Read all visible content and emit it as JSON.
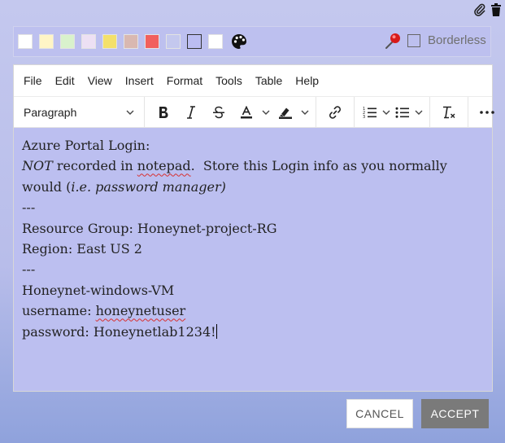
{
  "top_icons": {
    "attach": "paperclip-icon",
    "delete": "trash-icon"
  },
  "palette": {
    "swatches": [
      "#ffffff",
      "#fff5c6",
      "#d9f2cc",
      "#ede0f4",
      "#f4e06b",
      "#d9b8b1",
      "#f1605d",
      "#c4c8ee",
      "#bbbdf2",
      "#ffffff"
    ],
    "selected_index": 8,
    "borderless_label": "Borderless",
    "borderless_checked": false
  },
  "menu": [
    "File",
    "Edit",
    "View",
    "Insert",
    "Format",
    "Tools",
    "Table",
    "Help"
  ],
  "toolbar": {
    "block_format": "Paragraph"
  },
  "content": {
    "line1": "Azure Portal Login:",
    "line2_em": "NOT",
    "line2_a": " recorded in ",
    "line2_b": "notepad",
    "line2_c": ".  Store this Login info as you normally",
    "line3_a": "would (",
    "line3_em": "i.e. password manager)",
    "line4": "---",
    "line5": "Resource Group: Honeynet-project-RG",
    "line6": "Region: East US 2",
    "line7": "---",
    "line8": "Honeynet-windows-VM",
    "line9_a": "username: ",
    "line9_b": "honeynetuser",
    "line10_a": "password: ",
    "line10_b": "Honeynetlab1234!"
  },
  "buttons": {
    "cancel": "CANCEL",
    "accept": "ACCEPT"
  }
}
